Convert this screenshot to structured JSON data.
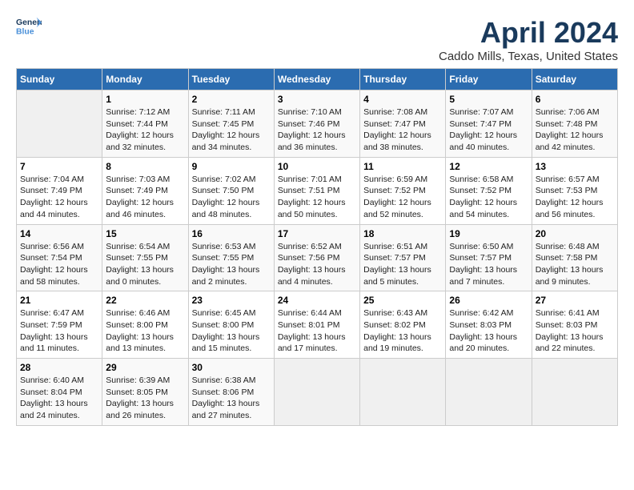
{
  "header": {
    "logo_line1": "General",
    "logo_line2": "Blue",
    "title": "April 2024",
    "subtitle": "Caddo Mills, Texas, United States"
  },
  "days_of_week": [
    "Sunday",
    "Monday",
    "Tuesday",
    "Wednesday",
    "Thursday",
    "Friday",
    "Saturday"
  ],
  "weeks": [
    [
      {
        "day": "",
        "sunrise": "",
        "sunset": "",
        "daylight": ""
      },
      {
        "day": "1",
        "sunrise": "Sunrise: 7:12 AM",
        "sunset": "Sunset: 7:44 PM",
        "daylight": "Daylight: 12 hours and 32 minutes."
      },
      {
        "day": "2",
        "sunrise": "Sunrise: 7:11 AM",
        "sunset": "Sunset: 7:45 PM",
        "daylight": "Daylight: 12 hours and 34 minutes."
      },
      {
        "day": "3",
        "sunrise": "Sunrise: 7:10 AM",
        "sunset": "Sunset: 7:46 PM",
        "daylight": "Daylight: 12 hours and 36 minutes."
      },
      {
        "day": "4",
        "sunrise": "Sunrise: 7:08 AM",
        "sunset": "Sunset: 7:47 PM",
        "daylight": "Daylight: 12 hours and 38 minutes."
      },
      {
        "day": "5",
        "sunrise": "Sunrise: 7:07 AM",
        "sunset": "Sunset: 7:47 PM",
        "daylight": "Daylight: 12 hours and 40 minutes."
      },
      {
        "day": "6",
        "sunrise": "Sunrise: 7:06 AM",
        "sunset": "Sunset: 7:48 PM",
        "daylight": "Daylight: 12 hours and 42 minutes."
      }
    ],
    [
      {
        "day": "7",
        "sunrise": "Sunrise: 7:04 AM",
        "sunset": "Sunset: 7:49 PM",
        "daylight": "Daylight: 12 hours and 44 minutes."
      },
      {
        "day": "8",
        "sunrise": "Sunrise: 7:03 AM",
        "sunset": "Sunset: 7:49 PM",
        "daylight": "Daylight: 12 hours and 46 minutes."
      },
      {
        "day": "9",
        "sunrise": "Sunrise: 7:02 AM",
        "sunset": "Sunset: 7:50 PM",
        "daylight": "Daylight: 12 hours and 48 minutes."
      },
      {
        "day": "10",
        "sunrise": "Sunrise: 7:01 AM",
        "sunset": "Sunset: 7:51 PM",
        "daylight": "Daylight: 12 hours and 50 minutes."
      },
      {
        "day": "11",
        "sunrise": "Sunrise: 6:59 AM",
        "sunset": "Sunset: 7:52 PM",
        "daylight": "Daylight: 12 hours and 52 minutes."
      },
      {
        "day": "12",
        "sunrise": "Sunrise: 6:58 AM",
        "sunset": "Sunset: 7:52 PM",
        "daylight": "Daylight: 12 hours and 54 minutes."
      },
      {
        "day": "13",
        "sunrise": "Sunrise: 6:57 AM",
        "sunset": "Sunset: 7:53 PM",
        "daylight": "Daylight: 12 hours and 56 minutes."
      }
    ],
    [
      {
        "day": "14",
        "sunrise": "Sunrise: 6:56 AM",
        "sunset": "Sunset: 7:54 PM",
        "daylight": "Daylight: 12 hours and 58 minutes."
      },
      {
        "day": "15",
        "sunrise": "Sunrise: 6:54 AM",
        "sunset": "Sunset: 7:55 PM",
        "daylight": "Daylight: 13 hours and 0 minutes."
      },
      {
        "day": "16",
        "sunrise": "Sunrise: 6:53 AM",
        "sunset": "Sunset: 7:55 PM",
        "daylight": "Daylight: 13 hours and 2 minutes."
      },
      {
        "day": "17",
        "sunrise": "Sunrise: 6:52 AM",
        "sunset": "Sunset: 7:56 PM",
        "daylight": "Daylight: 13 hours and 4 minutes."
      },
      {
        "day": "18",
        "sunrise": "Sunrise: 6:51 AM",
        "sunset": "Sunset: 7:57 PM",
        "daylight": "Daylight: 13 hours and 5 minutes."
      },
      {
        "day": "19",
        "sunrise": "Sunrise: 6:50 AM",
        "sunset": "Sunset: 7:57 PM",
        "daylight": "Daylight: 13 hours and 7 minutes."
      },
      {
        "day": "20",
        "sunrise": "Sunrise: 6:48 AM",
        "sunset": "Sunset: 7:58 PM",
        "daylight": "Daylight: 13 hours and 9 minutes."
      }
    ],
    [
      {
        "day": "21",
        "sunrise": "Sunrise: 6:47 AM",
        "sunset": "Sunset: 7:59 PM",
        "daylight": "Daylight: 13 hours and 11 minutes."
      },
      {
        "day": "22",
        "sunrise": "Sunrise: 6:46 AM",
        "sunset": "Sunset: 8:00 PM",
        "daylight": "Daylight: 13 hours and 13 minutes."
      },
      {
        "day": "23",
        "sunrise": "Sunrise: 6:45 AM",
        "sunset": "Sunset: 8:00 PM",
        "daylight": "Daylight: 13 hours and 15 minutes."
      },
      {
        "day": "24",
        "sunrise": "Sunrise: 6:44 AM",
        "sunset": "Sunset: 8:01 PM",
        "daylight": "Daylight: 13 hours and 17 minutes."
      },
      {
        "day": "25",
        "sunrise": "Sunrise: 6:43 AM",
        "sunset": "Sunset: 8:02 PM",
        "daylight": "Daylight: 13 hours and 19 minutes."
      },
      {
        "day": "26",
        "sunrise": "Sunrise: 6:42 AM",
        "sunset": "Sunset: 8:03 PM",
        "daylight": "Daylight: 13 hours and 20 minutes."
      },
      {
        "day": "27",
        "sunrise": "Sunrise: 6:41 AM",
        "sunset": "Sunset: 8:03 PM",
        "daylight": "Daylight: 13 hours and 22 minutes."
      }
    ],
    [
      {
        "day": "28",
        "sunrise": "Sunrise: 6:40 AM",
        "sunset": "Sunset: 8:04 PM",
        "daylight": "Daylight: 13 hours and 24 minutes."
      },
      {
        "day": "29",
        "sunrise": "Sunrise: 6:39 AM",
        "sunset": "Sunset: 8:05 PM",
        "daylight": "Daylight: 13 hours and 26 minutes."
      },
      {
        "day": "30",
        "sunrise": "Sunrise: 6:38 AM",
        "sunset": "Sunset: 8:06 PM",
        "daylight": "Daylight: 13 hours and 27 minutes."
      },
      {
        "day": "",
        "sunrise": "",
        "sunset": "",
        "daylight": ""
      },
      {
        "day": "",
        "sunrise": "",
        "sunset": "",
        "daylight": ""
      },
      {
        "day": "",
        "sunrise": "",
        "sunset": "",
        "daylight": ""
      },
      {
        "day": "",
        "sunrise": "",
        "sunset": "",
        "daylight": ""
      }
    ]
  ]
}
